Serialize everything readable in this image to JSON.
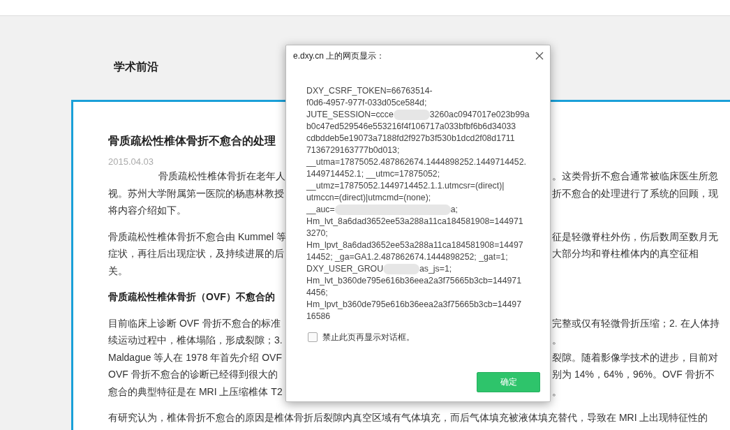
{
  "page": {
    "section_title": "学术前沿"
  },
  "article": {
    "title": "骨质疏松性椎体骨折不愈合的处理",
    "date": "2015.04.03",
    "blocks": [
      {
        "kind": "paragraph",
        "lines": [
          {
            "left": "骨质疏松性椎体骨折在老年人",
            "right": "。这类骨折不愈合通常被临床医生所忽",
            "indented": true
          },
          {
            "left": "视。苏州大学附属第一医院的杨惠林教授",
            "right": "折不愈合的处理进行了系统的回顾，现"
          },
          {
            "left": "将内容介绍如下。"
          }
        ]
      },
      {
        "kind": "paragraph",
        "lines": [
          {
            "left": "骨质疏松性椎体骨折不愈合由 Kummel 等",
            "right": "征是轻微脊柱外伤，伤后数周至数月无"
          },
          {
            "left": "症状，再往后出现症状，及持续进展的后",
            "right": "大部分均和脊柱椎体内的真空征相"
          },
          {
            "left": "关。"
          }
        ]
      },
      {
        "kind": "heading",
        "lines": [
          {
            "left": "骨质疏松性椎体骨折（OVF）不愈合的"
          }
        ]
      },
      {
        "kind": "paragraph",
        "lines": [
          {
            "left": "目前临床上诊断 OVF 骨折不愈合的标准",
            "right": "完整或仅有轻微骨折压缩；2. 在人体持"
          },
          {
            "left": "续运动过程中，椎体塌陷，形成裂隙；3.",
            "right": "。"
          },
          {
            "left": "Maldague 等人在 1978 年首先介绍 OVF",
            "right": "裂隙。随着影像学技术的进步，目前对"
          },
          {
            "left": "OVF 骨折不愈合的诊断已经得到很大的",
            "right": "别为 14%，64%，96%。OVF 骨折不"
          },
          {
            "left": "愈合的典型特征是在 MRI 上压缩椎体 T2",
            "right": "。"
          }
        ]
      },
      {
        "kind": "paragraph",
        "lines": [
          {
            "left": "有研究认为，椎体骨折不愈合的原因是椎体骨折后裂隙内真空区域有气体填充，而后气体填充被液体填充替代，导致在 MRI 上出现特征性的"
          }
        ]
      }
    ]
  },
  "dialog": {
    "title": "e.dxy.cn 上的网页显示：",
    "message_lines": [
      {
        "parts": [
          {
            "kind": "text",
            "text": "DXY_CSRF_TOKEN=66763514-"
          }
        ]
      },
      {
        "parts": [
          {
            "kind": "text",
            "text": "f0d6-4957-977f-033d05ce584d;"
          }
        ]
      },
      {
        "parts": [
          {
            "kind": "text",
            "text": "JUTE_SESSION=ccce"
          },
          {
            "kind": "blur"
          },
          {
            "kind": "text",
            "text": "3260ac0947017e023b99a"
          }
        ]
      },
      {
        "parts": [
          {
            "kind": "text",
            "text": "b0c47ed529546e553216f4f106717a033bfbf6b6d34033"
          }
        ]
      },
      {
        "parts": [
          {
            "kind": "text",
            "text": "cdbddeb5e19073a7188fd2f927b3f530b1dcd2f08d1711"
          }
        ]
      },
      {
        "parts": [
          {
            "kind": "text",
            "text": "7136729163777b0d013;"
          }
        ]
      },
      {
        "parts": [
          {
            "kind": "text",
            "text": "__utma=17875052.487862674.1444898252.1449714452."
          }
        ]
      },
      {
        "parts": [
          {
            "kind": "text",
            "text": "1449714452.1; __utmc=17875052;"
          }
        ]
      },
      {
        "parts": [
          {
            "kind": "text",
            "text": "__utmz=17875052.1449714452.1.1.utmcsr=(direct)|"
          }
        ]
      },
      {
        "parts": [
          {
            "kind": "text",
            "text": "utmccn=(direct)|utmcmd=(none);"
          }
        ]
      },
      {
        "parts": [
          {
            "kind": "text",
            "text": "__auc="
          },
          {
            "kind": "smear"
          },
          {
            "kind": "text",
            "text": "a;"
          }
        ]
      },
      {
        "parts": [
          {
            "kind": "text",
            "text": "Hm_lvt_8a6dad3652ee53a288a11ca184581908=144971"
          }
        ]
      },
      {
        "parts": [
          {
            "kind": "text",
            "text": "3270;"
          }
        ]
      },
      {
        "parts": [
          {
            "kind": "text",
            "text": "Hm_lpvt_8a6dad3652ee53a288a11ca184581908=14497"
          }
        ]
      },
      {
        "parts": [
          {
            "kind": "text",
            "text": "14452; _ga=GA1.2.487862674.1444898252; _gat=1;"
          }
        ]
      },
      {
        "parts": [
          {
            "kind": "text",
            "text": "DXY_USER_GROU"
          },
          {
            "kind": "blur"
          },
          {
            "kind": "text",
            "text": "as_js=1;"
          }
        ]
      },
      {
        "parts": [
          {
            "kind": "text",
            "text": "Hm_lvt_b360de795e616b36eea2a3f75665b3cb=144971"
          }
        ]
      },
      {
        "parts": [
          {
            "kind": "text",
            "text": "4456;"
          }
        ]
      },
      {
        "parts": [
          {
            "kind": "text",
            "text": "Hm_lpvt_b360de795e616b36eea2a3f75665b3cb=14497"
          }
        ]
      },
      {
        "parts": [
          {
            "kind": "text",
            "text": "16586"
          }
        ]
      }
    ],
    "checkbox": {
      "label": "禁止此页再显示对话框。",
      "checked": false
    },
    "button": "确定"
  }
}
